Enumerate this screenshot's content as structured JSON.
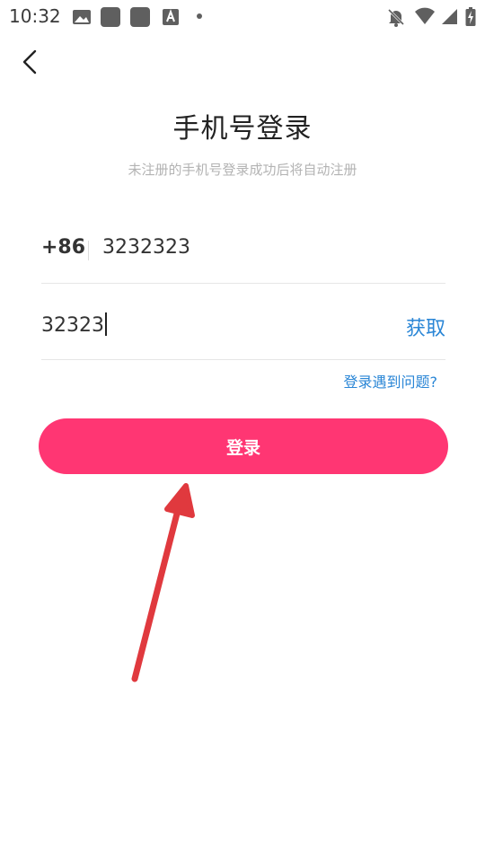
{
  "status_bar": {
    "time": "10:32",
    "left_icons": [
      "image-icon",
      "app-square-icon",
      "app-square-icon",
      "font-a-icon",
      "dot-icon"
    ],
    "right_icons": [
      "notifications-off-icon",
      "wifi-icon",
      "cellular-signal-icon",
      "battery-charging-icon"
    ]
  },
  "header": {
    "back_icon": "chevron-left-icon",
    "title": "手机号登录",
    "subtitle": "未注册的手机号登录成功后将自动注册"
  },
  "form": {
    "country_code": "+86",
    "phone_value": "3232323",
    "code_value": "32323",
    "get_code_label": "获取",
    "trouble_label": "登录遇到问题?",
    "login_label": "登录"
  },
  "colors": {
    "accent_pink": "#ff3673",
    "link_blue": "#2a86d6",
    "annotation_red": "#e0393e"
  }
}
